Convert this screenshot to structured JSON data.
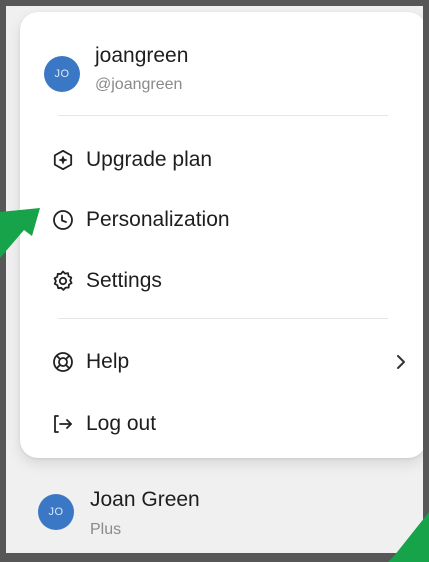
{
  "account": {
    "avatar_initials": "JO",
    "username": "joangreen",
    "handle": "@joangreen"
  },
  "menu": {
    "items": [
      {
        "label": "Upgrade plan",
        "icon": "upgrade-plan-icon"
      },
      {
        "label": "Personalization",
        "icon": "personalization-icon"
      },
      {
        "label": "Settings",
        "icon": "gear-icon"
      },
      {
        "label": "Help",
        "icon": "lifebuoy-icon",
        "has_submenu": true
      },
      {
        "label": "Log out",
        "icon": "log-out-icon"
      }
    ]
  },
  "profile": {
    "avatar_initials": "JO",
    "full_name": "Joan Green",
    "plan": "Plus"
  },
  "colors": {
    "avatar": "#3a78c5",
    "annotation_arrow": "#17a34a",
    "frame_border": "#575757"
  }
}
